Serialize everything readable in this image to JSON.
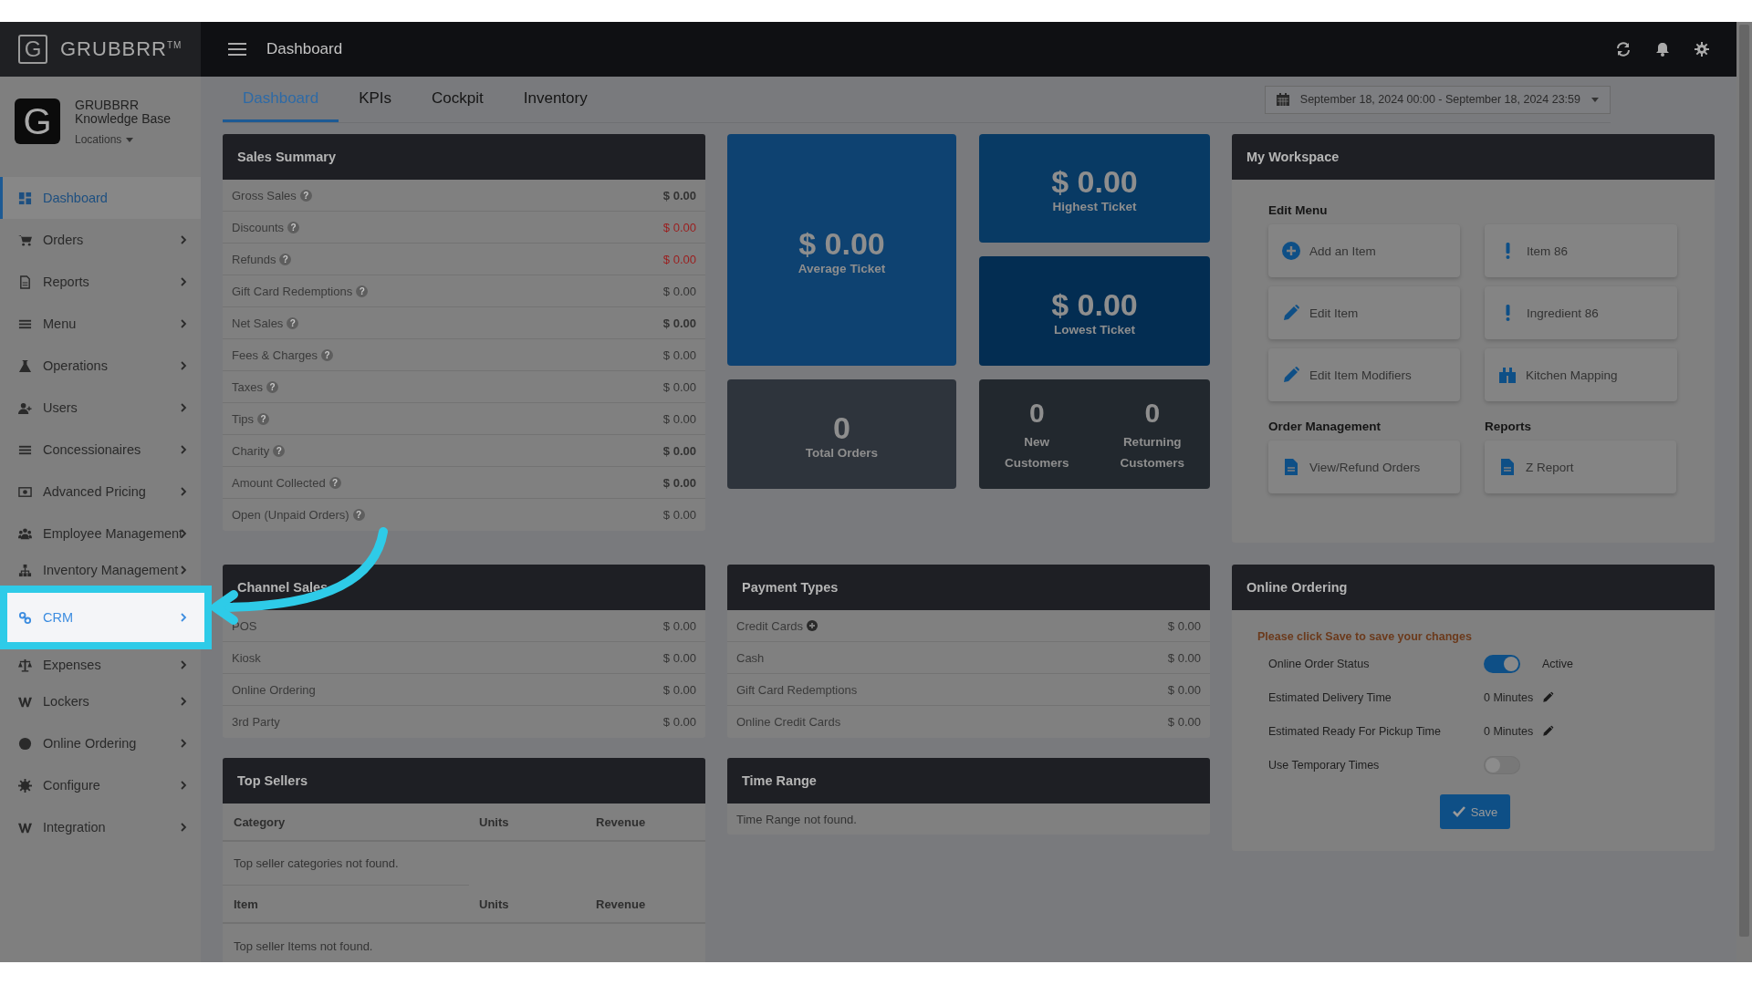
{
  "brand": {
    "logo_letter": "G",
    "name": "GRUBBRR$^{TM}$"
  },
  "profile": {
    "avatar_letter": "G",
    "name": "GRUBBRR Knowledge Base",
    "locations": "Locations"
  },
  "sidebar": {
    "items": [
      {
        "label": "Dashboard",
        "selected": true,
        "highlighted": false,
        "has_submenu": false
      },
      {
        "label": "Orders",
        "selected": false,
        "highlighted": false,
        "has_submenu": true
      },
      {
        "label": "Reports",
        "selected": false,
        "highlighted": false,
        "has_submenu": true
      },
      {
        "label": "Menu",
        "selected": false,
        "highlighted": false,
        "has_submenu": true
      },
      {
        "label": "Operations",
        "selected": false,
        "highlighted": false,
        "has_submenu": true
      },
      {
        "label": "Users",
        "selected": false,
        "highlighted": false,
        "has_submenu": true
      },
      {
        "label": "Concessionaires",
        "selected": false,
        "highlighted": false,
        "has_submenu": true
      },
      {
        "label": "Advanced Pricing",
        "selected": false,
        "highlighted": false,
        "has_submenu": true
      },
      {
        "label": "Employee Management",
        "selected": false,
        "highlighted": false,
        "has_submenu": true
      },
      {
        "label": "Inventory Management",
        "selected": false,
        "highlighted": false,
        "has_submenu": true
      },
      {
        "label": "CRM",
        "selected": false,
        "highlighted": true,
        "has_submenu": true
      },
      {
        "label": "Expenses",
        "selected": false,
        "highlighted": false,
        "has_submenu": true
      },
      {
        "label": "Lockers",
        "selected": false,
        "highlighted": false,
        "has_submenu": true
      },
      {
        "label": "Online Ordering",
        "selected": false,
        "highlighted": false,
        "has_submenu": true
      },
      {
        "label": "Configure",
        "selected": false,
        "highlighted": false,
        "has_submenu": true
      },
      {
        "label": "Integration",
        "selected": false,
        "highlighted": false,
        "has_submenu": true
      }
    ]
  },
  "topbar": {
    "title": "Dashboard"
  },
  "tabs": [
    {
      "label": "Dashboard",
      "selected": true
    },
    {
      "label": "KPIs",
      "selected": false
    },
    {
      "label": "Cockpit",
      "selected": false
    },
    {
      "label": "Inventory",
      "selected": false
    }
  ],
  "date_range": "September 18, 2024 00:00 - September 18, 2024 23:59",
  "sales_summary": {
    "title": "Sales Summary",
    "rows": [
      {
        "label": "Gross Sales",
        "help": "?",
        "value": "$ 0.00",
        "kind": "total"
      },
      {
        "label": "Discounts",
        "help": "?",
        "value": "$ 0.00",
        "kind": "deduction"
      },
      {
        "label": "Refunds",
        "help": "?",
        "value": "$ 0.00",
        "kind": "deduction"
      },
      {
        "label": "Gift Card Redemptions",
        "help": "?",
        "value": "$ 0.00",
        "kind": "plain"
      },
      {
        "label": "Net Sales",
        "help": "?",
        "value": "$ 0.00",
        "kind": "total"
      },
      {
        "label": "Fees & Charges",
        "help": "?",
        "value": "$ 0.00",
        "kind": "plain"
      },
      {
        "label": "Taxes",
        "help": "?",
        "value": "$ 0.00",
        "kind": "plain"
      },
      {
        "label": "Tips",
        "help": "?",
        "value": "$ 0.00",
        "kind": "plain"
      },
      {
        "label": "Charity",
        "help": "?",
        "value": "$ 0.00",
        "kind": "total"
      },
      {
        "label": "Amount Collected",
        "help": "?",
        "value": "$ 0.00",
        "kind": "total"
      },
      {
        "label": "Open (Unpaid Orders)",
        "help": "?",
        "value": "$ 0.00",
        "kind": "plain"
      }
    ]
  },
  "tiles": [
    {
      "kind": "single",
      "value": "$ 0.00",
      "label": "Average Ticket",
      "color": "#0e4271"
    },
    {
      "kind": "single",
      "value": "$ 0.00",
      "label": "Highest Ticket",
      "color": "#083a64"
    },
    {
      "kind": "single",
      "value": "$ 0.00",
      "label": "Lowest Ticket",
      "color": "#032d52"
    },
    {
      "kind": "single",
      "value": "0",
      "label": "Total Orders",
      "color": "#2e343c"
    },
    {
      "kind": "pair",
      "color": "#22282e",
      "stats": [
        {
          "value": "0",
          "label": "New Customers"
        },
        {
          "value": "0",
          "label": "Returning Customers"
        }
      ]
    }
  ],
  "workspace": {
    "title": "My Workspace",
    "edit_menu": {
      "title": "Edit Menu",
      "buttons": [
        "Add an Item",
        "Item 86",
        "Edit Item",
        "Ingredient 86",
        "Edit Item Modifiers",
        "Kitchen Mapping"
      ]
    },
    "order_management": {
      "title": "Order Management",
      "buttons": [
        "View/Refund Orders"
      ]
    },
    "reports": {
      "title": "Reports",
      "buttons": [
        "Z Report"
      ]
    }
  },
  "channel_sales": {
    "title": "Channel Sales",
    "rows": [
      {
        "label": "POS",
        "value": "$ 0.00",
        "expandable": false
      },
      {
        "label": "Kiosk",
        "value": "$ 0.00",
        "expandable": false
      },
      {
        "label": "Online Ordering",
        "value": "$ 0.00",
        "expandable": false
      },
      {
        "label": "3rd Party",
        "value": "$ 0.00",
        "expandable": false
      }
    ]
  },
  "payment_types": {
    "title": "Payment Types",
    "rows": [
      {
        "label": "Credit Cards",
        "value": "$ 0.00",
        "expandable": true
      },
      {
        "label": "Cash",
        "value": "$ 0.00",
        "expandable": false
      },
      {
        "label": "Gift Card Redemptions",
        "value": "$ 0.00",
        "expandable": false
      },
      {
        "label": "Online Credit Cards",
        "value": "$ 0.00",
        "expandable": false
      }
    ]
  },
  "online_ordering": {
    "title": "Online Ordering",
    "notice": "Please click Save to save your changes",
    "fields": [
      {
        "kind": "toggle",
        "label": "Online Order Status",
        "on": true,
        "status": "Active"
      },
      {
        "kind": "minutes",
        "label": "Estimated Delivery Time",
        "value": "0 Minutes"
      },
      {
        "kind": "minutes",
        "label": "Estimated Ready For Pickup Time",
        "value": "0 Minutes"
      },
      {
        "kind": "toggle",
        "label": "Use Temporary Times",
        "on": false
      }
    ],
    "save_label": "Save"
  },
  "top_sellers": {
    "title": "Top Sellers",
    "category_table": {
      "columns": [
        "Category",
        "Units",
        "Revenue"
      ],
      "empty": "Top seller categories not found."
    },
    "item_table": {
      "columns": [
        "Item",
        "Units",
        "Revenue"
      ],
      "empty": "Top seller Items not found."
    }
  },
  "time_range": {
    "title": "Time Range",
    "empty": "Time Range not found."
  }
}
